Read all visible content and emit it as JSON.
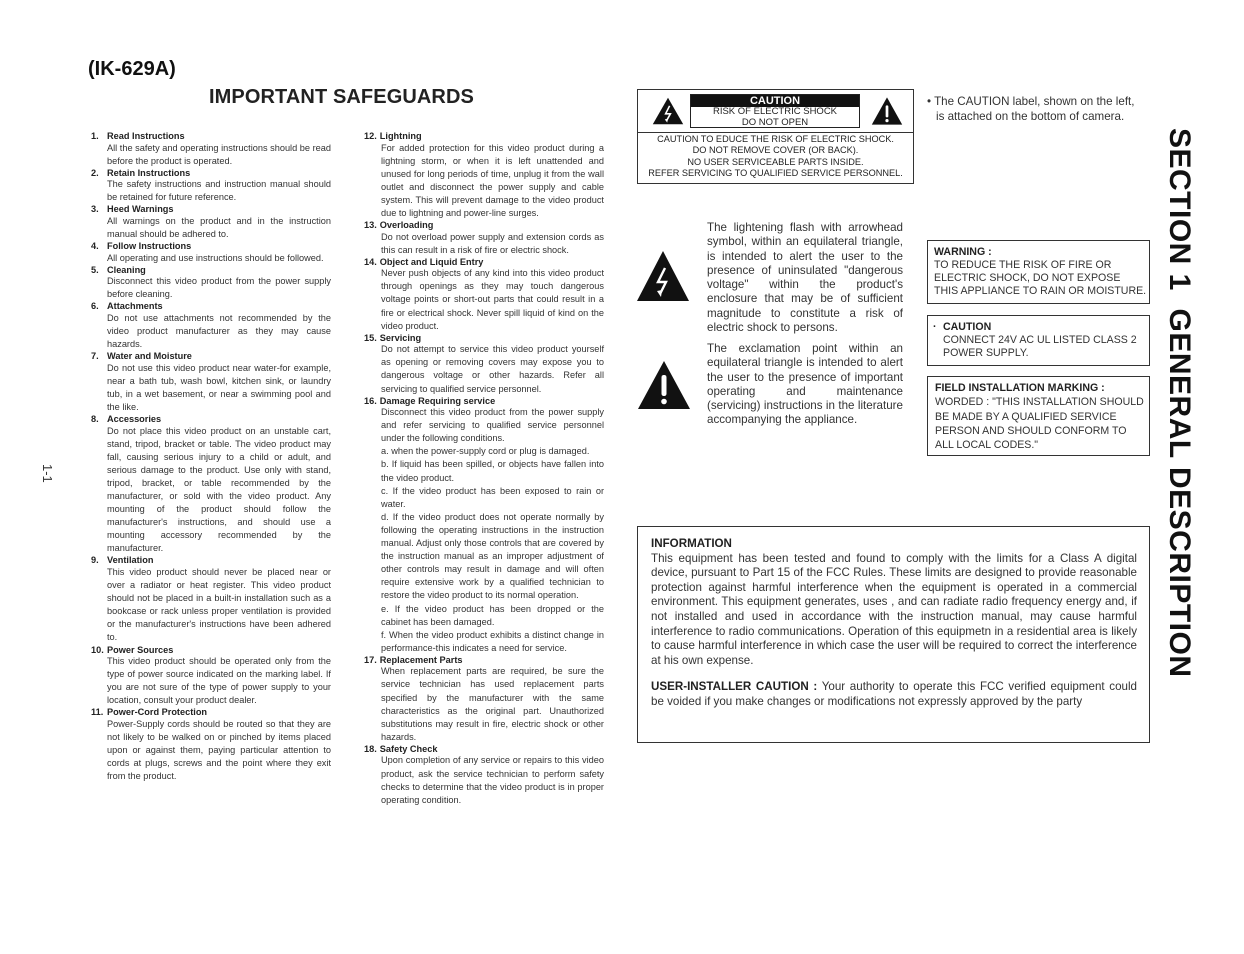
{
  "header": {
    "model": "(IK-629A)",
    "title": "IMPORTANT SAFEGUARDS"
  },
  "safeguards": {
    "column1": [
      {
        "num": "1.",
        "title": "Read Instructions",
        "body": [
          "All the safety and operating instructions should be read before the product is operated."
        ]
      },
      {
        "num": "2.",
        "title": "Retain Instructions",
        "body": [
          "The safety instructions and instruction manual should be retained for future reference."
        ]
      },
      {
        "num": "3.",
        "title": "Heed Warnings",
        "body": [
          "All warnings on the product and in the instruction manual should be adhered to."
        ]
      },
      {
        "num": "4.",
        "title": "Follow Instructions",
        "body": [
          "All operating and use instructions should be followed."
        ]
      },
      {
        "num": "5.",
        "title": "Cleaning",
        "body": [
          "Disconnect this video product from the power supply before cleaning."
        ]
      },
      {
        "num": "6.",
        "title": "Attachments",
        "body": [
          "Do not use attachments not recommended by the video product manufacturer as they may cause hazards."
        ]
      },
      {
        "num": "7.",
        "title": "Water and Moisture",
        "body": [
          "Do not use this video product near water-for example, near a bath tub, wash bowl, kitchen sink, or laundry tub, in a wet basement, or near a swimming pool and the like."
        ]
      },
      {
        "num": "8.",
        "title": "Accessories",
        "body": [
          "Do not place this video product on an unstable cart, stand, tripod, bracket or table. The video product may fall, causing serious injury to a child or adult, and serious damage to the product. Use only with stand, tripod, bracket, or table recommended by the manufacturer, or sold with the video product. Any mounting of the product should follow the manufacturer's instructions, and should use a mounting accessory recommended by the manufacturer."
        ]
      },
      {
        "num": "9.",
        "title": "Ventilation",
        "body": [
          "This video product should never be placed near or over a radiator or heat register. This video product should not be placed in a built-in installation such as a bookcase or rack unless proper ventilation is provided or the manufacturer's instructions have been adhered to."
        ]
      },
      {
        "num": "10.",
        "title": "Power Sources",
        "body": [
          "This video product should be operated only from the type of power source indicated on the marking label. If you are not sure of the type of power supply to your location, consult your product dealer."
        ]
      },
      {
        "num": "11.",
        "title": "Power-Cord Protection",
        "body": [
          "Power-Supply cords should be routed so that they are not likely to be walked on or pinched by items placed upon or against them, paying particular attention to cords at plugs, screws and the point where they exit from the product."
        ]
      }
    ],
    "column2": [
      {
        "num": "12.",
        "title": "Lightning",
        "body": [
          "For added protection for this video product during a lightning storm, or when it is left unattended and unused for long periods of time, unplug it from the wall outlet and disconnect the power supply and cable system. This will prevent damage to the video product due to lightning and power-line surges."
        ]
      },
      {
        "num": "13.",
        "title": "Overloading",
        "body": [
          "Do not overload power supply and extension cords as this can result in a risk of fire or electric shock."
        ]
      },
      {
        "num": "14.",
        "title": "Object and Liquid Entry",
        "body": [
          "Never push objects of any kind into this video product through openings as they may touch dangerous voltage points or short-out parts that could result in a fire or electrical shock. Never spill liquid of kind on the video product."
        ]
      },
      {
        "num": "15.",
        "title": "Servicing",
        "body": [
          "Do not attempt to service this video product yourself as opening or removing covers may expose you to dangerous voltage or other hazards. Refer all servicing to qualified service personnel."
        ]
      },
      {
        "num": "16.",
        "title": "Damage Requiring service",
        "body": [
          "Disconnect this video product from the power supply and refer servicing to qualified service personnel under the following conditions.",
          "a. when the power-supply cord or plug is damaged.",
          "b. If liquid has been spilled, or objects have fallen into the video product.",
          "c. If the video product has been exposed to rain or water.",
          "d. If the video product does not operate normally by following the operating instructions in the instruction manual. Adjust only those controls that are covered by the instruction manual as an improper adjustment of other controls may result in damage and will often require extensive work by a qualified technician to restore the video product to its normal operation.",
          "e. If the video product has been dropped or the cabinet has been damaged.",
          "f. When the video product exhibits a distinct change in performance-this indicates a need for service."
        ]
      },
      {
        "num": "17.",
        "title": "Replacement Parts",
        "body": [
          "When replacement parts are required, be sure the service technician has used replacement parts specified by the manufacturer with the same characteristics as the original part. Unauthorized substitutions may result in fire, electric shock or other hazards."
        ]
      },
      {
        "num": "18.",
        "title": "Safety Check",
        "body": [
          "Upon completion of any service or repairs to this video product, ask the service technician to perform safety checks to determine that the video product is in proper operating condition."
        ]
      }
    ]
  },
  "caution_label": {
    "banner": "CAUTION",
    "line1": "RISK OF ELECTRIC SHOCK",
    "line2": "DO NOT OPEN",
    "bottom": [
      "CAUTION TO EDUCE THE RISK OF ELECTRIC SHOCK.",
      "DO NOT REMOVE COVER (OR BACK).",
      "NO USER SERVICEABLE PARTS INSIDE.",
      "REFER SERVICING TO QUALIFIED SERVICE PERSONNEL."
    ],
    "left_icon": "lightning-triangle-icon",
    "right_icon": "exclamation-triangle-icon"
  },
  "label_note": {
    "line1": "• The CAUTION label, shown on the left,",
    "line2": "is attached on the bottom of camera."
  },
  "symbols": {
    "lightning": {
      "icon": "lightning-triangle-icon",
      "text": "The lightening flash with arrowhead symbol, within an equilateral triangle, is intended to alert the user to the presence of uninsulated \"dangerous voltage\" within the product's enclosure that may be of sufficient magnitude to constitute a risk of electric shock to persons."
    },
    "exclamation": {
      "icon": "exclamation-triangle-icon",
      "text": "The exclamation point within an equilateral triangle is intended to alert the user to the presence of important operating and maintenance (servicing) instructions in the literature accompanying the appliance."
    }
  },
  "warning_box": {
    "heading": "WARNING :",
    "lines": [
      "TO REDUCE THE RISK OF FIRE OR",
      "ELECTRIC SHOCK, DO NOT EXPOSE",
      "THIS APPLIANCE TO RAIN OR MOISTURE."
    ]
  },
  "caution_box": {
    "bullet": "·",
    "heading": "CAUTION",
    "lines": [
      "CONNECT 24V AC UL LISTED CLASS 2",
      "POWER SUPPLY."
    ]
  },
  "field_box": {
    "heading": "FIELD INSTALLATION MARKING :",
    "lines": [
      "WORDED : \"THIS INSTALLATION SHOULD",
      "BE MADE BY A QUALIFIED SERVICE",
      "PERSON AND SHOULD CONFORM TO",
      "ALL LOCAL CODES.\""
    ]
  },
  "information": {
    "heading": "INFORMATION",
    "body": "This equipment has been tested and found to comply with the limits for a Class A digital device, pursuant to Part 15 of the  FCC Rules. These limits are designed to provide reasonable protection against harmful interference when the equipment is operated in a commercial environment. This equipment generates, uses , and can radiate radio frequency energy and, if not installed and used in accordance with the instruction manual, may cause harmful interference to radio communications. Operation of this equipmetn in a residential area is likely to cause harmful interference in which case the user will be required to correct the interference at his own expense.",
    "user_caution_label": "USER-INSTALLER CAUTION :",
    "user_caution_text": " Your authority to operate this FCC verified equipment could be voided if you make changes or modifications not expressly approved by the party"
  },
  "section_title": "SECTION 1  GENERAL DESCRIPTION",
  "page_number": "1-1"
}
